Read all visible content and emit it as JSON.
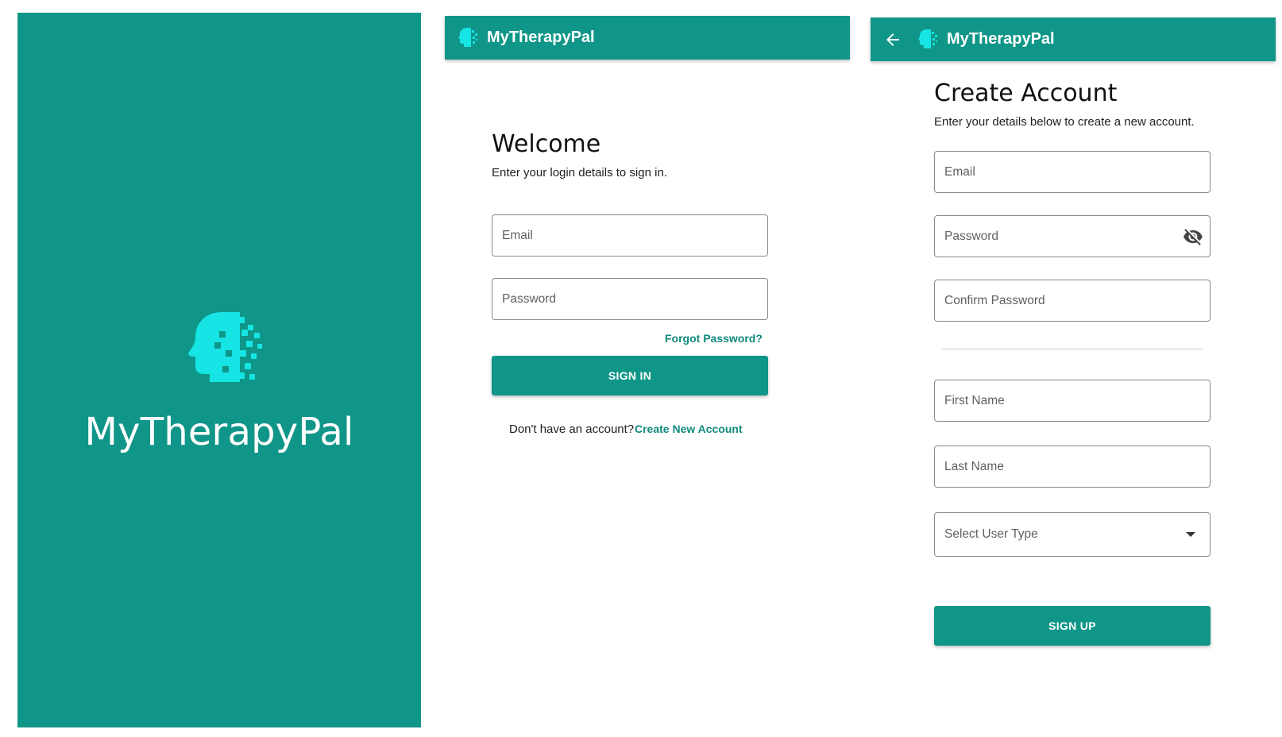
{
  "app_name": "MyTherapyPal",
  "colors": {
    "primary": "#109688",
    "icon_accent": "#17e4e4",
    "link": "#0f8a7d"
  },
  "splash": {
    "icon": "brain-head-icon",
    "title": "MyTherapyPal"
  },
  "login": {
    "appbar_title": "MyTherapyPal",
    "heading": "Welcome",
    "subheading": "Enter your login details to sign in.",
    "email_placeholder": "Email",
    "password_placeholder": "Password",
    "forgot_password": "Forgot Password?",
    "sign_in": "SIGN IN",
    "no_account": "Don't have an account?",
    "create_account": "Create New Account"
  },
  "register": {
    "appbar_title": "MyTherapyPal",
    "heading": "Create Account",
    "subheading": "Enter your details below to create a new account.",
    "email_placeholder": "Email",
    "password_placeholder": "Password",
    "confirm_password_placeholder": "Confirm Password",
    "first_name_placeholder": "First Name",
    "last_name_placeholder": "Last Name",
    "user_type_placeholder": "Select User Type",
    "sign_up": "SIGN UP"
  }
}
